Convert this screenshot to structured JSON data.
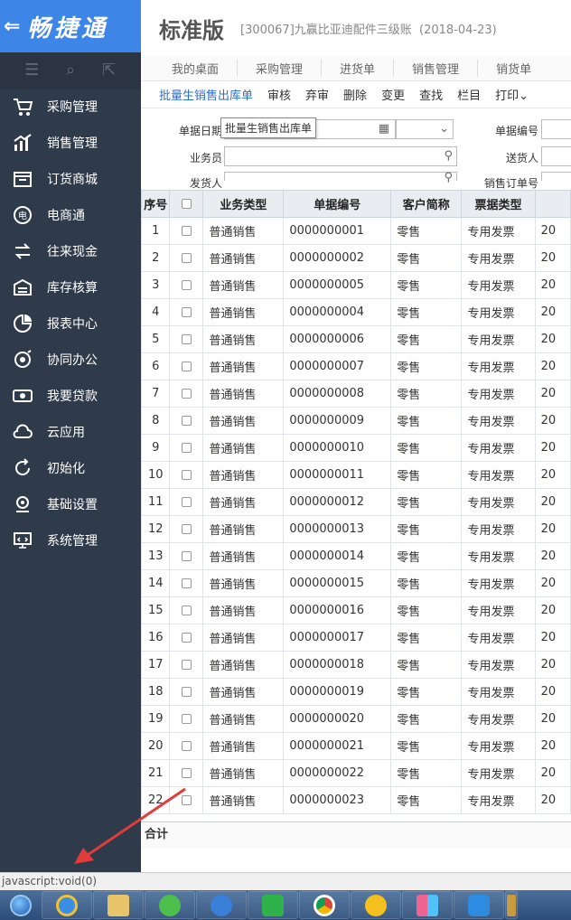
{
  "brand": {
    "back": "⇐",
    "name": "畅捷通"
  },
  "nav": [
    {
      "label": "采购管理",
      "icon": "cart-icon"
    },
    {
      "label": "销售管理",
      "icon": "chart-icon"
    },
    {
      "label": "订货商城",
      "icon": "store-icon"
    },
    {
      "label": "电商通",
      "icon": "ecommerce-icon"
    },
    {
      "label": "往来现金",
      "icon": "exchange-icon"
    },
    {
      "label": "库存核算",
      "icon": "warehouse-icon"
    },
    {
      "label": "报表中心",
      "icon": "pie-icon"
    },
    {
      "label": "协同办公",
      "icon": "collab-icon"
    },
    {
      "label": "我要贷款",
      "icon": "cash-icon"
    },
    {
      "label": "云应用",
      "icon": "cloud-icon"
    },
    {
      "label": "初始化",
      "icon": "refresh-icon"
    },
    {
      "label": "基础设置",
      "icon": "settings-icon"
    },
    {
      "label": "系统管理",
      "icon": "monitor-icon"
    }
  ],
  "header": {
    "edition": "标准版",
    "company": "[300067]九赢比亚迪配件三级账",
    "date": "(2018-04-23)"
  },
  "tabs": [
    "我的桌面",
    "采购管理",
    "进货单",
    "销售管理",
    "销货单"
  ],
  "toolbar": {
    "batch": "批量生销售出库单",
    "audit": "审核",
    "unaudit": "弃审",
    "delete": "删除",
    "change": "变更",
    "find": "查找",
    "columns": "栏目",
    "print": "打印"
  },
  "tooltip": "批量生销售出库单",
  "filters": {
    "doc_date": "单据日期",
    "doc_no": "单据编号",
    "salesman": "业务员",
    "deliverer": "送货人",
    "shipper": "发货人",
    "sales_order_no": "销售订单号"
  },
  "table": {
    "headers": [
      "序号",
      "",
      "业务类型",
      "单据编号",
      "客户简称",
      "票据类型"
    ],
    "rows": [
      [
        "1",
        "普通销售",
        "0000000001",
        "零售",
        "专用发票",
        "20"
      ],
      [
        "2",
        "普通销售",
        "0000000002",
        "零售",
        "专用发票",
        "20"
      ],
      [
        "3",
        "普通销售",
        "0000000005",
        "零售",
        "专用发票",
        "20"
      ],
      [
        "4",
        "普通销售",
        "0000000004",
        "零售",
        "专用发票",
        "20"
      ],
      [
        "5",
        "普通销售",
        "0000000006",
        "零售",
        "专用发票",
        "20"
      ],
      [
        "6",
        "普通销售",
        "0000000007",
        "零售",
        "专用发票",
        "20"
      ],
      [
        "7",
        "普通销售",
        "0000000008",
        "零售",
        "专用发票",
        "20"
      ],
      [
        "8",
        "普通销售",
        "0000000009",
        "零售",
        "专用发票",
        "20"
      ],
      [
        "9",
        "普通销售",
        "0000000010",
        "零售",
        "专用发票",
        "20"
      ],
      [
        "10",
        "普通销售",
        "0000000011",
        "零售",
        "专用发票",
        "20"
      ],
      [
        "11",
        "普通销售",
        "0000000012",
        "零售",
        "专用发票",
        "20"
      ],
      [
        "12",
        "普通销售",
        "0000000013",
        "零售",
        "专用发票",
        "20"
      ],
      [
        "13",
        "普通销售",
        "0000000014",
        "零售",
        "专用发票",
        "20"
      ],
      [
        "14",
        "普通销售",
        "0000000015",
        "零售",
        "专用发票",
        "20"
      ],
      [
        "15",
        "普通销售",
        "0000000016",
        "零售",
        "专用发票",
        "20"
      ],
      [
        "16",
        "普通销售",
        "0000000017",
        "零售",
        "专用发票",
        "20"
      ],
      [
        "17",
        "普通销售",
        "0000000018",
        "零售",
        "专用发票",
        "20"
      ],
      [
        "18",
        "普通销售",
        "0000000019",
        "零售",
        "专用发票",
        "20"
      ],
      [
        "19",
        "普通销售",
        "0000000020",
        "零售",
        "专用发票",
        "20"
      ],
      [
        "20",
        "普通销售",
        "0000000021",
        "零售",
        "专用发票",
        "20"
      ],
      [
        "21",
        "普通销售",
        "0000000022",
        "零售",
        "专用发票",
        "20"
      ],
      [
        "22",
        "普通销售",
        "0000000023",
        "零售",
        "专用发票",
        "20"
      ]
    ],
    "total_label": "合计"
  },
  "statusbar": "javascript:void(0)",
  "colors": {
    "sidebar": "#2f3a4a",
    "brand": "#3d86e8",
    "link": "#2a6fd6"
  }
}
